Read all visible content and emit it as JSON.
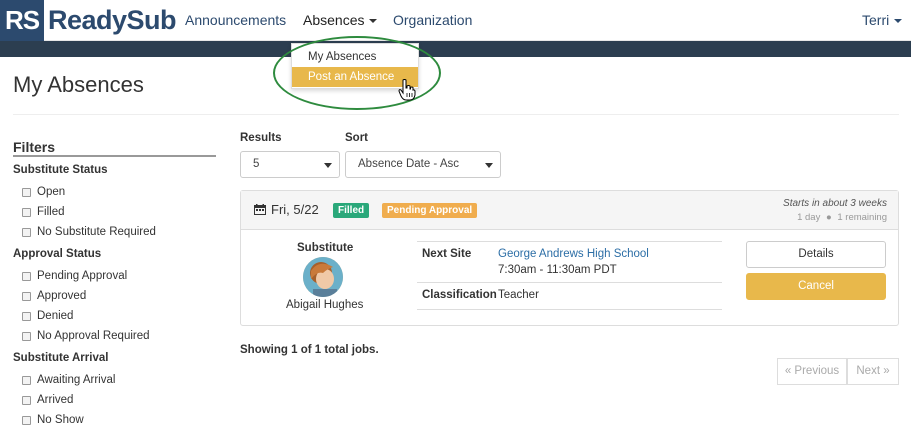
{
  "brand": {
    "logo_mark": "RS",
    "logo_text": "ReadySub",
    "accent": "#2c4a6e"
  },
  "nav": {
    "announcements": "Announcements",
    "absences": "Absences",
    "organization": "Organization",
    "user": "Terri"
  },
  "dropdown": {
    "items": [
      "My Absences",
      "Post an Absence"
    ],
    "active_item": "Post an Absence"
  },
  "page": {
    "title": "My Absences"
  },
  "filters": {
    "title": "Filters",
    "groups": [
      {
        "title": "Substitute Status",
        "options": [
          "Open",
          "Filled",
          "No Substitute Required"
        ]
      },
      {
        "title": "Approval Status",
        "options": [
          "Pending Approval",
          "Approved",
          "Denied",
          "No Approval Required"
        ]
      },
      {
        "title": "Substitute Arrival",
        "options": [
          "Awaiting Arrival",
          "Arrived",
          "No Show"
        ]
      }
    ]
  },
  "controls": {
    "results_label": "Results",
    "results_value": "5",
    "sort_label": "Sort",
    "sort_value": "Absence Date - Asc"
  },
  "job": {
    "date": "Fri, 5/22",
    "status_badge": "Filled",
    "approval_badge": "Pending Approval",
    "starts": "Starts in about 3 weeks",
    "duration": "1 day",
    "remaining": "1 remaining",
    "substitute_label": "Substitute",
    "substitute_name": "Abigail Hughes",
    "next_site_label": "Next Site",
    "next_site": "George Andrews High School",
    "time": "7:30am - 11:30am PDT",
    "classification_label": "Classification",
    "classification": "Teacher",
    "details_button": "Details",
    "cancel_button": "Cancel"
  },
  "footer": {
    "showing": "Showing 1 of 1 total jobs.",
    "previous": "« Previous",
    "next": "Next »"
  },
  "colors": {
    "filled": "#2aa87a",
    "pending": "#f0ad4e",
    "cancel": "#e8b84b",
    "highlight_ring": "#2e8b3e"
  }
}
